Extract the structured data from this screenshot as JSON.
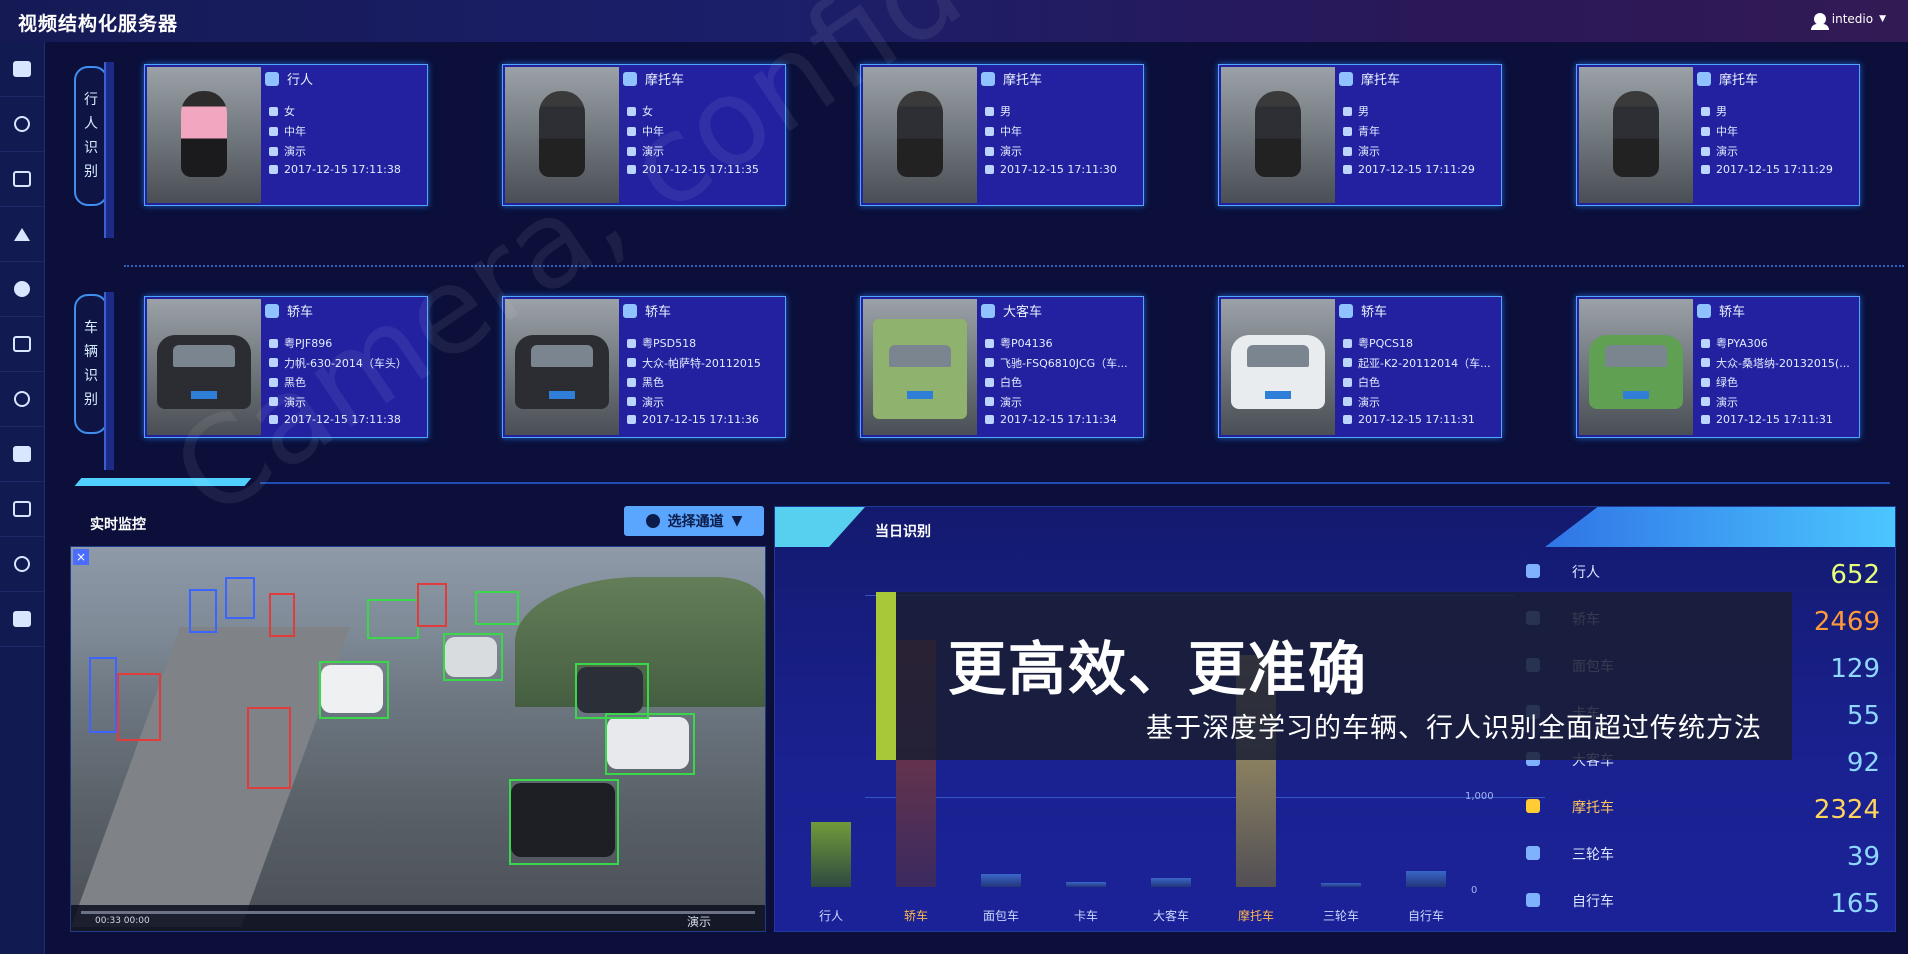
{
  "app": {
    "title": "视频结构化服务器",
    "user": "intedio"
  },
  "sidebar": {
    "items": [
      "dashboard-icon",
      "search-icon",
      "camera-icon",
      "network-icon",
      "car-icon",
      "vehicle-icon",
      "face-icon",
      "shield-icon",
      "monitor-icon",
      "settings-icon",
      "window-icon"
    ]
  },
  "rows": {
    "pedestrian_label": [
      "行",
      "人",
      "识",
      "别"
    ],
    "vehicle_label": [
      "车",
      "辆",
      "识",
      "别"
    ]
  },
  "pedestrian_cards": [
    {
      "type": "行人",
      "gender": "女",
      "age": "中年",
      "source": "演示",
      "time": "2017-12-15 17:11:38"
    },
    {
      "type": "摩托车",
      "gender": "女",
      "age": "中年",
      "source": "演示",
      "time": "2017-12-15 17:11:35"
    },
    {
      "type": "摩托车",
      "gender": "男",
      "age": "中年",
      "source": "演示",
      "time": "2017-12-15 17:11:30"
    },
    {
      "type": "摩托车",
      "gender": "男",
      "age": "青年",
      "source": "演示",
      "time": "2017-12-15 17:11:29"
    },
    {
      "type": "摩托车",
      "gender": "男",
      "age": "中年",
      "source": "演示",
      "time": "2017-12-15 17:11:29"
    }
  ],
  "vehicle_cards": [
    {
      "type": "轿车",
      "plate": "粤PJF896",
      "model": "力帆-630-2014（车头）",
      "color": "黑色",
      "source": "演示",
      "time": "2017-12-15 17:11:38"
    },
    {
      "type": "轿车",
      "plate": "粤PSD518",
      "model": "大众-帕萨特-20112015",
      "color": "黑色",
      "source": "演示",
      "time": "2017-12-15 17:11:36"
    },
    {
      "type": "大客车",
      "plate": "粤P04136",
      "model": "飞驰-FSQ6810JCG（车...",
      "color": "白色",
      "source": "演示",
      "time": "2017-12-15 17:11:34"
    },
    {
      "type": "轿车",
      "plate": "粤PQCS18",
      "model": "起亚-K2-20112014（车...",
      "color": "白色",
      "source": "演示",
      "time": "2017-12-15 17:11:31"
    },
    {
      "type": "轿车",
      "plate": "粤PYA306",
      "model": "大众-桑塔纳-20132015(...",
      "color": "绿色",
      "source": "演示",
      "time": "2017-12-15 17:11:31"
    }
  ],
  "monitor": {
    "title": "实时监控",
    "select_label": "选择通道",
    "close_glyph": "×",
    "time_label": "00:33  00:00",
    "overlay_text": "演示"
  },
  "stats": {
    "title": "当日识别",
    "tick_1000": "1,000",
    "tick_0": "0"
  },
  "chart_data": {
    "type": "bar",
    "categories": [
      "行人",
      "轿车",
      "面包车",
      "卡车",
      "大客车",
      "摩托车",
      "三轮车",
      "自行车"
    ],
    "values": [
      652,
      2469,
      129,
      55,
      92,
      2324,
      39,
      165
    ],
    "title": "当日识别",
    "highlight": [
      "轿车",
      "摩托车"
    ]
  },
  "legend": [
    {
      "name": "行人",
      "value": "652",
      "icon": "pedestrian-icon"
    },
    {
      "name": "轿车",
      "value": "2469",
      "icon": "car-icon"
    },
    {
      "name": "面包车",
      "value": "129",
      "icon": "van-icon"
    },
    {
      "name": "卡车",
      "value": "55",
      "icon": "truck-icon"
    },
    {
      "name": "大客车",
      "value": "92",
      "icon": "bus-icon"
    },
    {
      "name": "摩托车",
      "value": "2324",
      "icon": "motorcycle-icon"
    },
    {
      "name": "三轮车",
      "value": "39",
      "icon": "tricycle-icon"
    },
    {
      "name": "自行车",
      "value": "165",
      "icon": "bicycle-icon"
    }
  ],
  "promo": {
    "headline": "更高效、更准确",
    "subline": "基于深度学习的车辆、行人识别全面超过传统方法"
  },
  "watermark": {
    "text": "Camera, confidential"
  },
  "colors": {
    "accent": "#4ea6ff",
    "highlight": "#ffb64a",
    "lime": "#a8c83a"
  }
}
